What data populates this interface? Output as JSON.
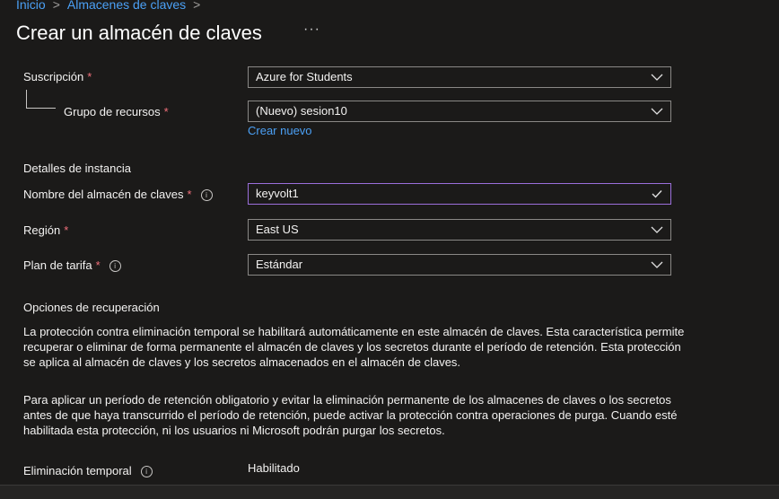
{
  "breadcrumb": {
    "home": "Inicio",
    "current": "Almacenes de claves",
    "separator": ">"
  },
  "page": {
    "title": "Crear un almacén de claves",
    "more": "···"
  },
  "form": {
    "subscription": {
      "label": "Suscripción",
      "value": "Azure for Students"
    },
    "resource_group": {
      "label": "Grupo de recursos",
      "value": "(Nuevo) sesion10",
      "create_new": "Crear nuevo"
    },
    "instance_section": "Detalles de instancia",
    "vault_name": {
      "label": "Nombre del almacén de claves",
      "value": "keyvolt1"
    },
    "region": {
      "label": "Región",
      "value": "East US"
    },
    "pricing": {
      "label": "Plan de tarifa",
      "value": "Estándar"
    },
    "recovery_section": "Opciones de recuperación",
    "para1": "La protección contra eliminación temporal se habilitará automáticamente en este almacén de claves. Esta característica permite recuperar o eliminar de forma permanente el almacén de claves y los secretos durante el período de retención. Esta protección se aplica al almacén de claves y los secretos almacenados en el almacén de claves.",
    "para2": "Para aplicar un período de retención obligatorio y evitar la eliminación permanente de los almacenes de claves o los secretos antes de que haya transcurrido el período de retención, puede activar la protección contra operaciones de purga. Cuando esté habilitada esta protección, ni los usuarios ni Microsoft podrán purgar los secretos.",
    "soft_delete": {
      "label": "Eliminación temporal",
      "value": "Habilitado"
    }
  },
  "required_mark": "*",
  "info_glyph": "i",
  "colors": {
    "accent": "#4ba0f5",
    "required": "#f1707b",
    "valid_border": "#9b6fdb",
    "background": "#1b1a19"
  }
}
